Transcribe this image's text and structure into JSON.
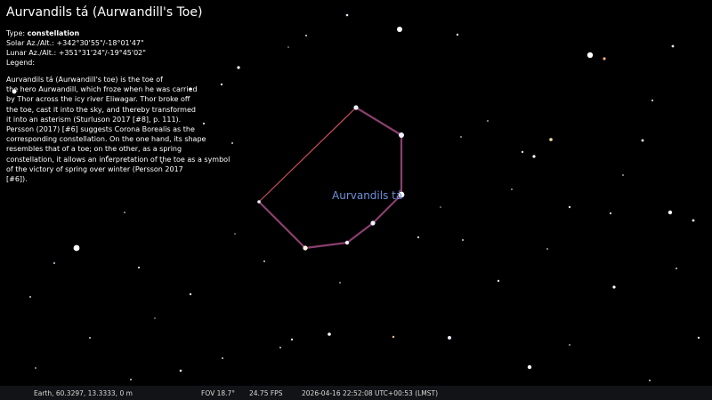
{
  "info_panel": {
    "title": "Aurvandils tá (Aurwandill's Toe)",
    "type_label": "Type:",
    "type_value": "constellation",
    "solar_label": "Solar Az./Alt.:",
    "solar_value": "+342°30'55\"/-18°01'47\"",
    "lunar_label": "Lunar Az./Alt.:",
    "lunar_value": "+351°31'24\"/-19°45'02\"",
    "legend_label": "Legend:",
    "description_lines": [
      "Aurvandils tá (Aurwandill's toe) is the toe of",
      "the hero Aurwandill, which froze when he was carried",
      "by Thor across the icy river Eliwagar. Thor broke off",
      "the toe, cast it into the sky, and thereby transformed",
      "it into an asterism (Sturluson 2017 [#8], p. 111).",
      "Persson (2017) [#6] suggests Corona Borealis as the",
      "corresponding constellation. On the one hand, its shape",
      "resembles that of a toe; on the other, as a spring",
      "constellation, it allows an interpretation of the toe as a symbol",
      "of the victory of spring over winter (Persson 2017",
      "[#6])."
    ]
  },
  "sky": {
    "constellation_label": "Aurvandils tá",
    "colors": {
      "background": "#000000",
      "constellation_line": "#8a3f6e",
      "selected_line": "#c94e5a",
      "label": "#6f8fd8"
    }
  },
  "status_bar": {
    "location": "Earth, 60.3297, 13.3333, 0 m",
    "fov": "FOV 18.7°",
    "fps": "24.75 FPS",
    "datetime": "2026-04-16 22:52:08 UTC+00:53 (LMST)"
  }
}
